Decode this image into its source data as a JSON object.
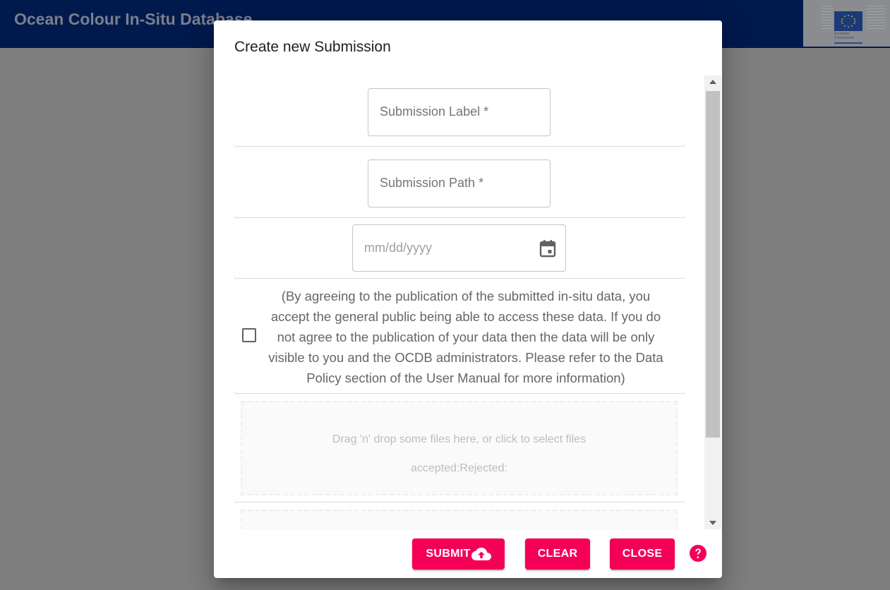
{
  "app": {
    "title": "Ocean Colour In-Situ Database",
    "logo": {
      "name": "European Commission logo",
      "text_line1": "European",
      "text_line2": "Commission"
    }
  },
  "dialog": {
    "title": "Create new Submission",
    "fields": {
      "submission_label": {
        "label": "Submission Label *",
        "value": ""
      },
      "submission_path": {
        "label": "Submission Path *",
        "value": ""
      },
      "date": {
        "placeholder": "mm/dd/yyyy",
        "value": "",
        "icon": "calendar-icon"
      }
    },
    "publication_checkbox": {
      "checked": false,
      "text": "(By agreeing to the publication of the submitted in-situ data, you accept the general public being able to access these data. If you do not agree to the publication of your data then the data will be only visible to you and the OCDB administrators. Please refer to the Data Policy section of the User Manual for more information)"
    },
    "dropzones": [
      {
        "instruction": "Drag 'n' drop some files here, or click to select files",
        "status": "accepted:Rejected:"
      },
      {
        "instruction": "",
        "status": ""
      }
    ],
    "actions": {
      "submit_label": "SUBMIT",
      "submit_icon": "cloud-upload-icon",
      "clear_label": "CLEAR",
      "close_label": "CLOSE",
      "help_icon": "help-circle-icon"
    }
  },
  "colors": {
    "header_bg": "#001a4d",
    "accent": "#f50057",
    "overlay": "#7f7f7f"
  }
}
